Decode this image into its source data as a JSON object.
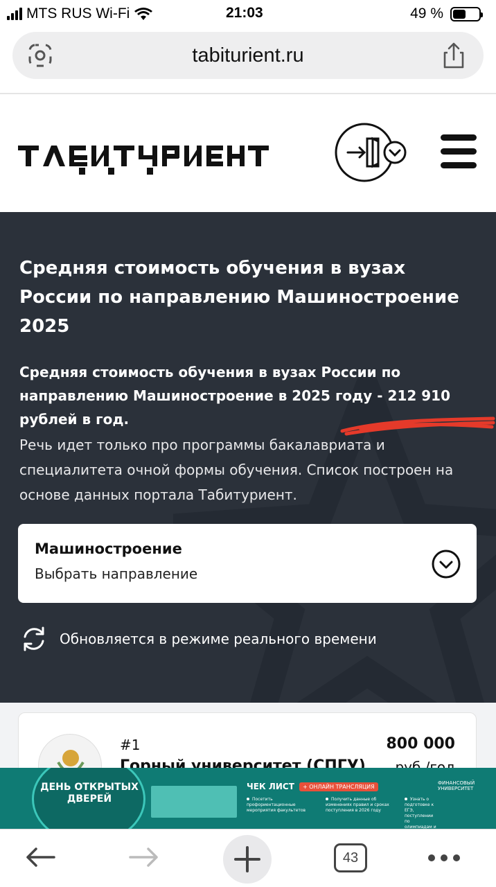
{
  "status_bar": {
    "carrier": "MTS RUS Wi-Fi",
    "time": "21:03",
    "battery": "49 %",
    "battery_level": 0.49
  },
  "browser": {
    "url": "tabiturient.ru",
    "tab_count": "43"
  },
  "header": {
    "logo_alt": "ТАБИТУРИЕНТ",
    "login_icon": "door-enter-icon",
    "menu_icon": "hamburger-menu-icon"
  },
  "hero": {
    "title": "Средняя стоимость обучения в вузах России по направлению Машиностроение 2025",
    "lead": "Средняя стоимость обучения в вузах России по направлению Машиностроение в 2025 году - 212 910 рублей в год.",
    "note": "Речь идет только про программы бакалавриата и специалитета очной формы обучения. Список построен на основе данных портала Табитуриент.",
    "select": {
      "value": "Машиностроение",
      "hint": "Выбрать направление"
    },
    "live_text": "Обновляется в режиме реального времени"
  },
  "ranking": [
    {
      "rank": "#1",
      "university": "Горный университет (СПГУ)",
      "price": "800 000",
      "unit": "руб./год"
    }
  ],
  "banner": {
    "open_days": "ДЕНЬ ОТКРЫТЫХ ДВЕРЕЙ",
    "checklist": "ЧЕК ЛИСТ",
    "online": "+ ОНЛАЙН ТРАНСЛЯЦИЯ",
    "items": [
      "Посетить профориентационные мероприятия факультетов",
      "Получить данные об изменениях правил и сроках поступления в 2026 году",
      "Узнать о подготовке к ЕГЭ, поступлении по олимпиадам и консультациях для иностранных граждан"
    ],
    "brand": "ФИНАНСОВЫЙ УНИВЕРСИТЕТ"
  },
  "colors": {
    "hero_bg": "#2b313a",
    "banner_bg": "#0f7b74",
    "scribble": "#e53a2a"
  }
}
